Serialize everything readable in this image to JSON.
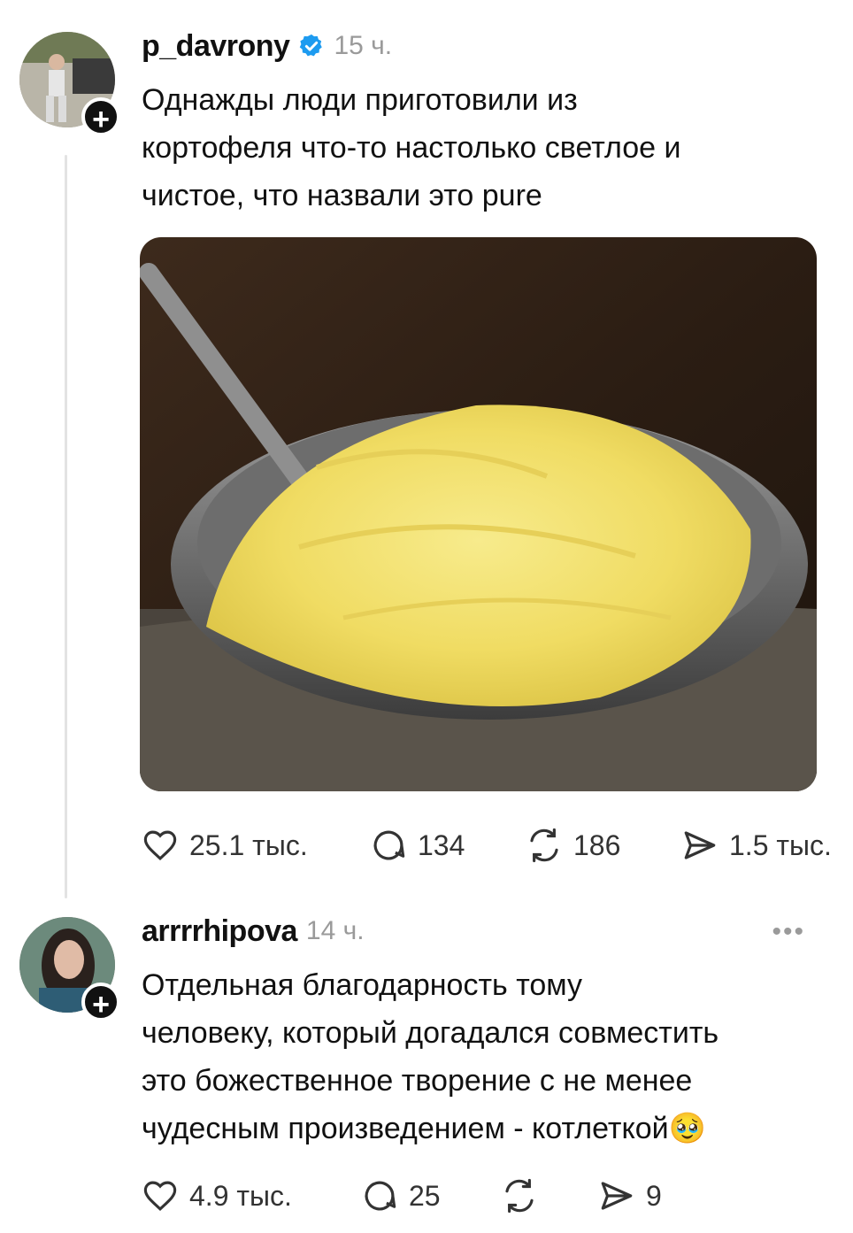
{
  "post": {
    "username": "p_davrony",
    "time": "15 ч.",
    "text": "Однажды люди приготовили из\nкортофеля что-то настолько светлое и\nчистое, что назвали это pure",
    "verified_icon": "verified-badge-icon",
    "image_alt": "mashed-potatoes-bowl",
    "actions": {
      "likes": "25.1 тыс.",
      "comments": "134",
      "reposts": "186",
      "shares": "1.5 тыс."
    }
  },
  "reply": {
    "username": "arrrrhipova",
    "time": "14 ч.",
    "text": "Отдельная благодарность тому\nчеловеку, который догадался совместить\nэто божественное творение с не менее\nчудесным произведением - котлеткой",
    "emoji": "🥹",
    "more_icon": "more-options-icon",
    "actions": {
      "likes": "4.9 тыс.",
      "comments": "25",
      "reposts": "",
      "shares": "9"
    }
  },
  "colors": {
    "text": "#111111",
    "muted": "#9a9a9a",
    "verified": "#1d9bf0",
    "thread_line": "#e3e3e3"
  }
}
